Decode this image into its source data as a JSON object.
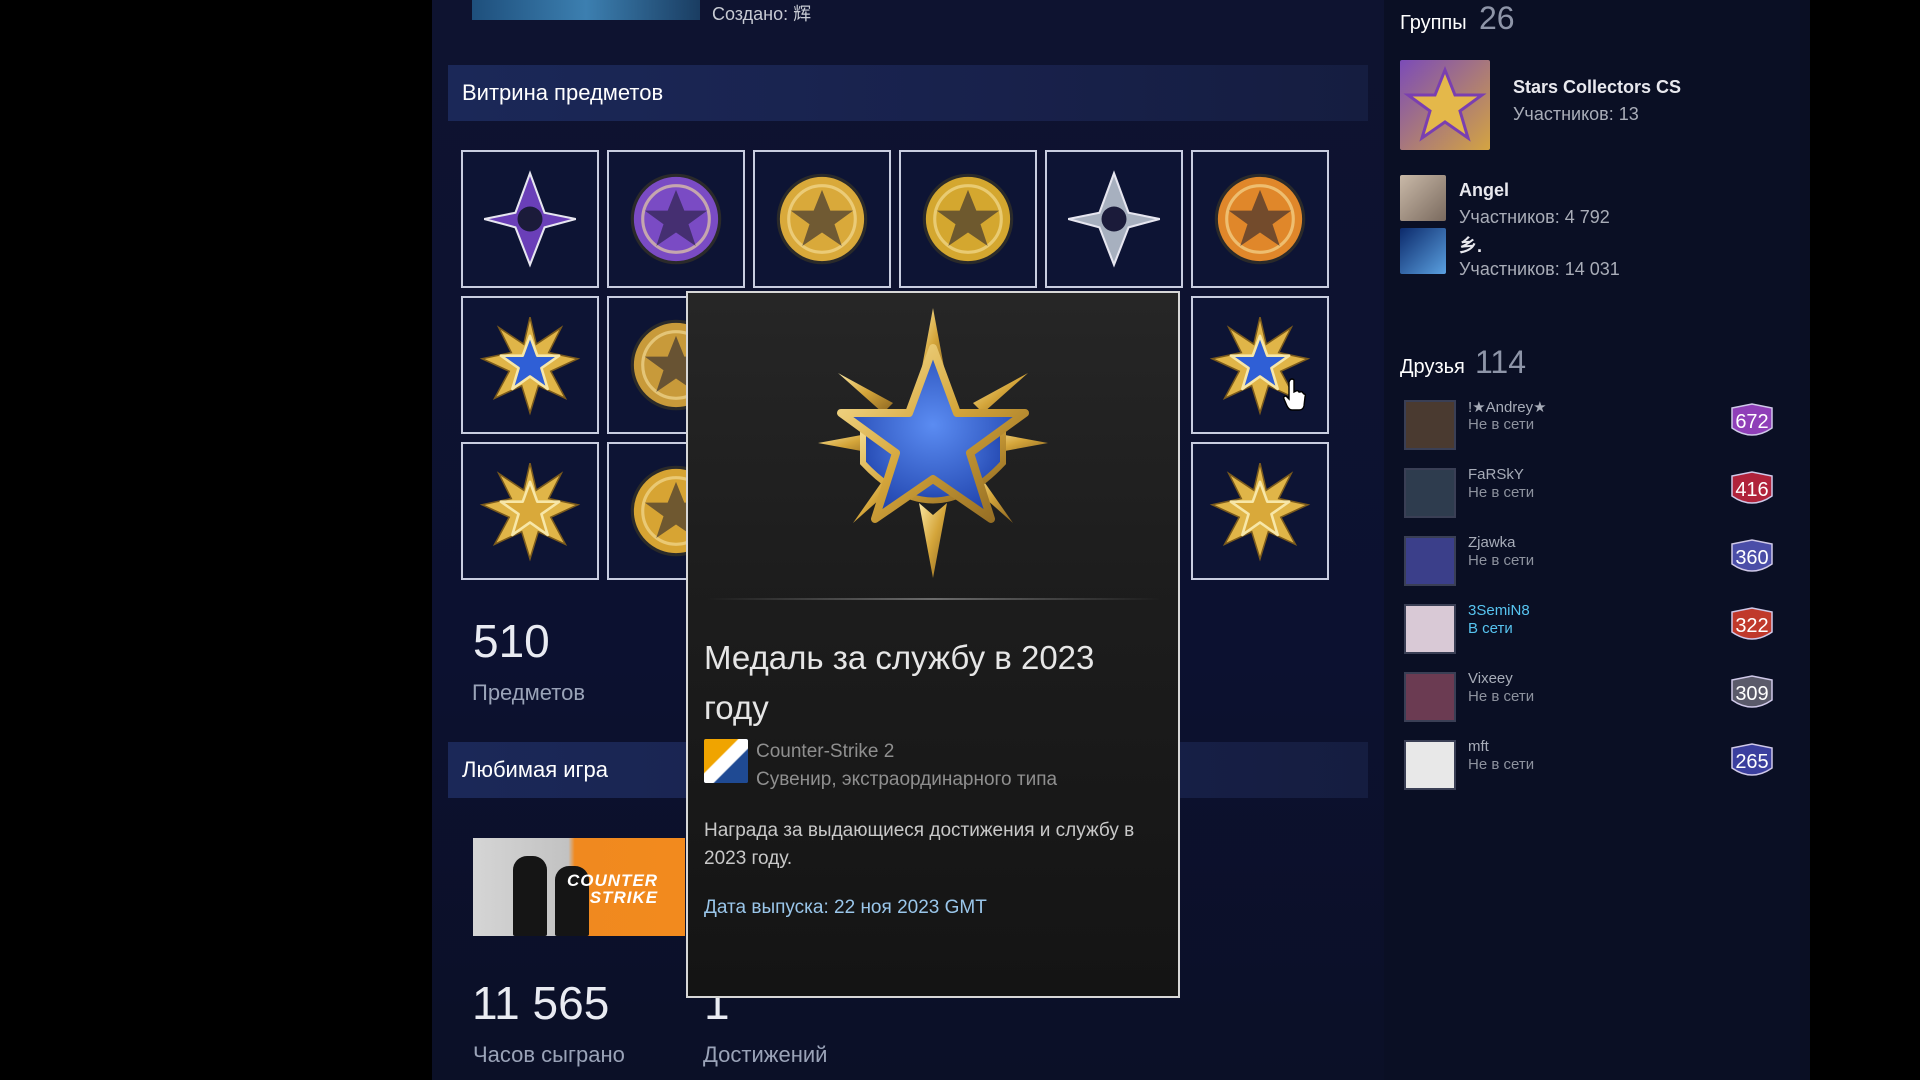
{
  "profile_header": {
    "created_label": "Создано: 辉"
  },
  "showcase": {
    "title": "Витрина предметов",
    "items": [
      {
        "name": "purple-warrior-emblem",
        "color": "#6a3fb8"
      },
      {
        "name": "purple-star-coin",
        "color": "#7a4bc4"
      },
      {
        "name": "gold-leopard-ring",
        "color": "#d9a93a"
      },
      {
        "name": "gold-star-coin",
        "color": "#d4a72f"
      },
      {
        "name": "silver-eagle-emblem",
        "color": "#a7b0bf"
      },
      {
        "name": "orange-star-coin",
        "color": "#e0872a"
      },
      {
        "name": "blue-service-medal",
        "color": "#2f5fd6"
      },
      {
        "name": "stockholm-coin",
        "color": "#c89a3a"
      },
      {
        "name": "blue-service-medal-2",
        "color": "#2f5fd6"
      },
      {
        "name": "gold-service-medal",
        "color": "#d9a93a"
      },
      {
        "name": "gold-coin-1",
        "color": "#d7a433"
      },
      {
        "name": "gold-service-medal-2",
        "color": "#d9a93a"
      }
    ],
    "items_count": "510",
    "items_label": "Предметов"
  },
  "favorite_game": {
    "title": "Любимая игра",
    "art_text_line1": "COUNTER",
    "art_text_line2": "STRIKE",
    "hours_value": "11 565",
    "hours_label": "Часов сыграно",
    "achievements_value": "1",
    "achievements_label": "Достижений"
  },
  "tooltip": {
    "title": "Медаль за службу в 2023 году",
    "game": "Counter-Strike 2",
    "type": "Сувенир, экстраординарного типа",
    "description": "Награда за выдающиеся достижения и службу в 2023 году.",
    "date": "Дата выпуска: 22 ноя 2023 GMT"
  },
  "groups": {
    "label": "Группы",
    "count": "26",
    "items": [
      {
        "name": "Stars Collectors CS",
        "members": "Участников: 13"
      },
      {
        "name": "Angel",
        "members": "Участников: 4 792"
      },
      {
        "name": "乡.",
        "members": "Участников: 14 031"
      }
    ]
  },
  "friends": {
    "label": "Друзья",
    "count": "114",
    "items": [
      {
        "name": "!★Andrey★",
        "status": "Не в сети",
        "level": "672",
        "badge_color": "#8f3fb8",
        "online": false
      },
      {
        "name": "FaRSkY",
        "status": "Не в сети",
        "level": "416",
        "badge_color": "#b0233b",
        "online": false
      },
      {
        "name": "Zjawka",
        "status": "Не в сети",
        "level": "360",
        "badge_color": "#4b4ea8",
        "online": false
      },
      {
        "name": "3SemiN8",
        "status": "В сети",
        "level": "322",
        "badge_color": "#c0392b",
        "online": true
      },
      {
        "name": "Vixeey",
        "status": "Не в сети",
        "level": "309",
        "badge_color": "#5a5a6a",
        "online": false
      },
      {
        "name": "mft",
        "status": "Не в сети",
        "level": "265",
        "badge_color": "#3b3f9e",
        "online": false
      }
    ]
  }
}
